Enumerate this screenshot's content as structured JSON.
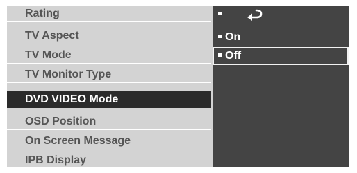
{
  "menu": {
    "items": [
      {
        "label": "Rating"
      },
      {
        "label": "TV Aspect"
      },
      {
        "label": "TV Mode"
      },
      {
        "label": "TV Monitor Type"
      },
      {
        "label": "DVD VIDEO Mode"
      },
      {
        "label": "OSD  Position"
      },
      {
        "label": "On Screen Message"
      },
      {
        "label": "IPB Display"
      }
    ],
    "selected_label": "DVD VIDEO Mode"
  },
  "options": {
    "return_icon": "return-arrow-icon",
    "items": [
      {
        "label": "On"
      },
      {
        "label": "Off"
      }
    ],
    "highlighted_label": "Off"
  },
  "colors": {
    "menu_background": "#d3d3d3",
    "menu_text": "#555555",
    "selected_background": "#2b2b2b",
    "selected_text": "#ffffff",
    "options_background": "#444444",
    "options_text": "#ffffff"
  }
}
